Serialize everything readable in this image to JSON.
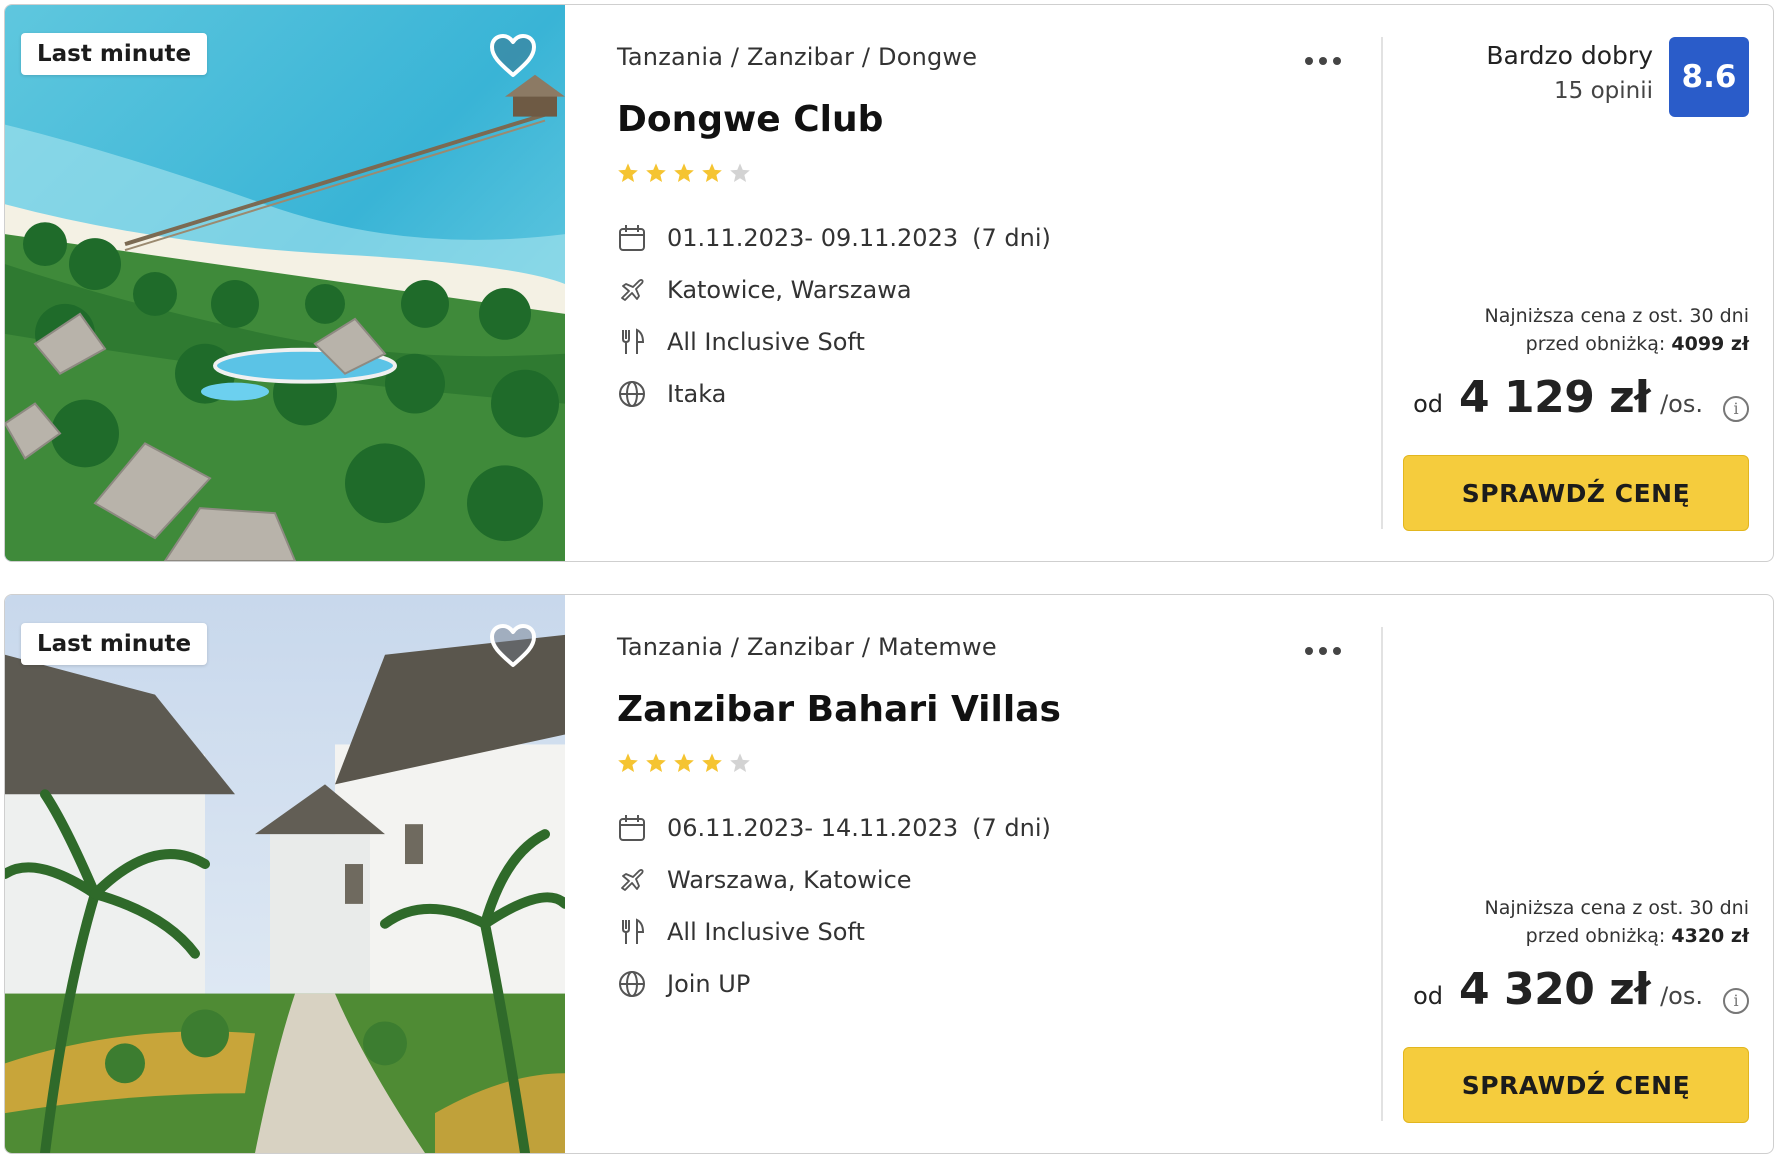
{
  "offers": [
    {
      "badge": "Last minute",
      "breadcrumb": "Tanzania / Zanzibar / Dongwe",
      "hotel_name": "Dongwe Club",
      "stars": {
        "filled": 4,
        "total": 5
      },
      "dates": "01.11.2023- 09.11.2023",
      "duration": "(7 dni)",
      "departure": "Katowice, Warszawa",
      "board": "All Inclusive Soft",
      "operator": "Itaka",
      "rating_label": "Bardzo dobry",
      "rating_count": "15 opinii",
      "rating_score": "8.6",
      "lowest_price_line1": "Najniższa cena z ost. 30 dni",
      "lowest_price_line2": "przed obniżką:",
      "lowest_price_value": "4099 zł",
      "price_prefix": "od",
      "price": "4 129 zł",
      "price_suffix": "/os.",
      "button_label": "SPRAWDŹ CENĘ"
    },
    {
      "badge": "Last minute",
      "breadcrumb": "Tanzania / Zanzibar / Matemwe",
      "hotel_name": "Zanzibar Bahari Villas",
      "stars": {
        "filled": 4,
        "total": 5
      },
      "dates": "06.11.2023- 14.11.2023",
      "duration": "(7 dni)",
      "departure": "Warszawa, Katowice",
      "board": "All Inclusive Soft",
      "operator": "Join UP",
      "lowest_price_line1": "Najniższa cena z ost. 30 dni",
      "lowest_price_line2": "przed obniżką:",
      "lowest_price_value": "4320 zł",
      "price_prefix": "od",
      "price": "4 320 zł",
      "price_suffix": "/os.",
      "button_label": "SPRAWDŹ CENĘ"
    }
  ],
  "icons": {
    "favorite": "heart-icon",
    "menu": "more-dots-icon",
    "date": "calendar-icon",
    "departure": "plane-icon",
    "board": "cutlery-icon",
    "operator": "globe-icon",
    "info": "info-icon",
    "star": "star-icon"
  },
  "colors": {
    "button_bg": "#f5cc3d",
    "score_bg": "#2a5cc9",
    "star_filled": "#f5c431",
    "star_empty": "#d3d3d3"
  }
}
